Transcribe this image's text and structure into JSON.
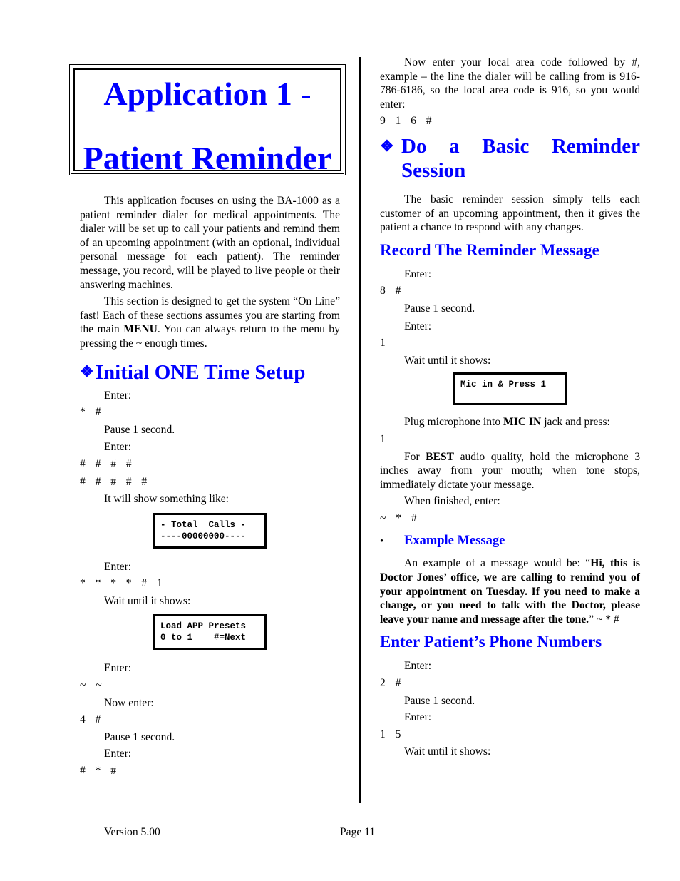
{
  "title": {
    "line1": "Application 1 -",
    "line2": "Patient Reminder"
  },
  "intro": {
    "p1": "This application focuses on using the BA-1000 as a patient reminder dialer for medical appointments.  The dialer will be set up to call your patients and remind them of an upcoming appointment (with an optional, individual personal message for each patient).  The reminder message, you record, will be played to live people or their answering machines.",
    "p2_before": "This section is designed to get the system “On Line” fast!  Each of these sections assumes you are starting from the main ",
    "p2_bold": "MENU",
    "p2_after": ".  You can always return to the menu by pressing the ~ enough times."
  },
  "setup": {
    "heading": "Initial ONE Time Setup",
    "icon": "diamond-four-icon",
    "enter1": "Enter:",
    "keys1": "*  #",
    "pause1": "Pause 1 second.",
    "enter2": "Enter:",
    "keys2": "#  #  #  #",
    "keys3": "#  #  #  #  #",
    "show_like": "It will show something like:",
    "lcd1_line1": "- Total  Calls -",
    "lcd1_line2": "----00000000----",
    "enter3": "Enter:",
    "keys4": "*  *  *  *  #  1",
    "wait1": "Wait until it shows:",
    "lcd2_line1": "Load APP Presets",
    "lcd2_line2": "0 to 1    #=Next",
    "enter4": "Enter:",
    "keys5": "~  ~",
    "now_enter": "Now enter:",
    "keys6": "4  #",
    "pause2": "Pause 1 second.",
    "enter5": "Enter:",
    "keys7": "#  *  #",
    "area_code_text": "Now enter your local area code followed by #, example – the line the dialer will be calling from is 916-786-6186, so the local area code is 916, so you would enter:",
    "keys8": "9  1  6  #"
  },
  "basic": {
    "heading": "Do a Basic Reminder Session",
    "icon": "diamond-four-icon",
    "description": "The basic reminder session simply tells each customer of an upcoming appointment, then it gives the patient a chance to respond with any changes."
  },
  "record": {
    "heading": "Record The Reminder Message",
    "enter1": "Enter:",
    "keys1": "8  #",
    "pause1": "Pause 1 second.",
    "enter2": "Enter:",
    "keys2": "1",
    "wait1": "Wait until it shows:",
    "lcd_line1": "Mic in & Press 1",
    "lcd_line2": "",
    "plug_before": "Plug microphone into ",
    "plug_bold": "MIC IN",
    "plug_after": " jack and press:",
    "keys3": "1",
    "best_before": "For ",
    "best_bold": "BEST",
    "best_after": " audio quality, hold the microphone 3 inches away from your mouth; when tone stops, immediately dictate your message.",
    "finished": "When finished, enter:",
    "keys4": "~  *  #"
  },
  "example": {
    "bullet": "•",
    "heading": "Example Message",
    "intro": "An example of a message would be:  “",
    "message_bold": "Hi, this is Doctor Jones’ office, we are calling to remind you of your appointment on Tuesday.  If you need to make a change, or you need to talk with the Doctor, please leave your name and message after the tone.",
    "closing": "” ~  *  #"
  },
  "phone": {
    "heading": "Enter Patient’s Phone Numbers",
    "enter1": "Enter:",
    "keys1": "2  #",
    "pause1": "Pause 1 second.",
    "enter2": "Enter:",
    "keys2": "1  5",
    "wait1": "Wait until it shows:"
  },
  "footer": {
    "version": "Version 5.00",
    "page": "Page 11"
  }
}
